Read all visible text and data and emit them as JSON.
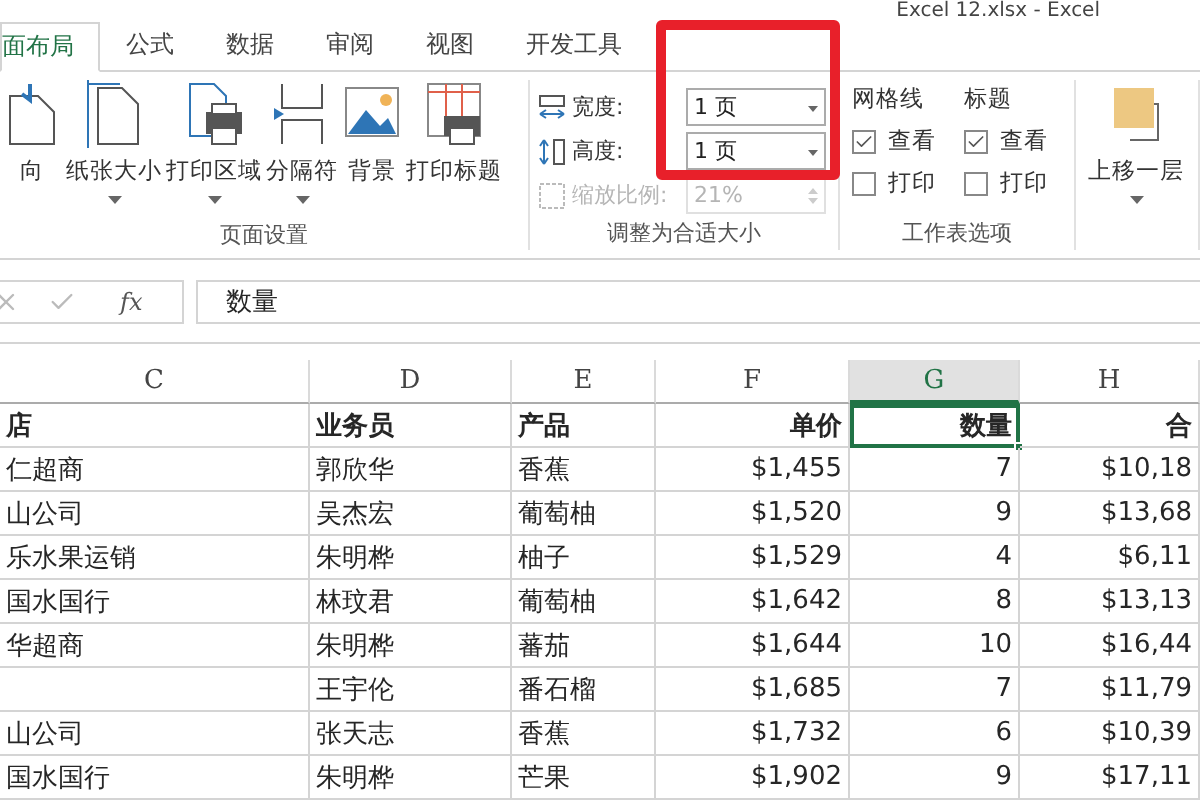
{
  "window": {
    "title": "Excel 12.xlsx - Excel"
  },
  "tabs": [
    {
      "label": "面布局",
      "selected": true
    },
    {
      "label": "公式",
      "selected": false
    },
    {
      "label": "数据",
      "selected": false
    },
    {
      "label": "审阅",
      "selected": false
    },
    {
      "label": "视图",
      "selected": false
    },
    {
      "label": "开发工具",
      "selected": false
    }
  ],
  "ribbon": {
    "page_setup": {
      "label": "页面设置",
      "buttons": [
        {
          "kind": "orientation",
          "label": "向",
          "dropdown": false
        },
        {
          "kind": "size",
          "label": "纸张大小",
          "dropdown": true
        },
        {
          "kind": "print-area",
          "label": "打印区域",
          "dropdown": true
        },
        {
          "kind": "breaks",
          "label": "分隔符",
          "dropdown": true
        },
        {
          "kind": "background",
          "label": "背景",
          "dropdown": false
        },
        {
          "kind": "print-titles",
          "label": "打印标题",
          "dropdown": false
        }
      ]
    },
    "scale_to_fit": {
      "label": "调整为合适大小",
      "highlighted": true,
      "fields": [
        {
          "kind": "width",
          "label": "宽度:",
          "value": "1 页",
          "disabled": false
        },
        {
          "kind": "height",
          "label": "高度:",
          "value": "1 页",
          "disabled": false
        },
        {
          "kind": "scale",
          "label": "缩放比例:",
          "value": "21%",
          "disabled": true
        }
      ]
    },
    "sheet_options": {
      "label": "工作表选项",
      "columns": [
        {
          "title": "网格线",
          "options": [
            {
              "label": "查看",
              "checked": true
            },
            {
              "label": "打印",
              "checked": false
            }
          ]
        },
        {
          "title": "标题",
          "options": [
            {
              "label": "查看",
              "checked": true
            },
            {
              "label": "打印",
              "checked": false
            }
          ]
        }
      ]
    },
    "arrange": {
      "buttons": [
        {
          "label": "上移一层",
          "dropdown": true
        }
      ]
    }
  },
  "formula_bar": {
    "function_label": "fx",
    "value": "数量"
  },
  "sheet": {
    "columns": [
      {
        "label": "C",
        "selected": false
      },
      {
        "label": "D",
        "selected": false
      },
      {
        "label": "E",
        "selected": false
      },
      {
        "label": "F",
        "selected": false
      },
      {
        "label": "G",
        "selected": true
      },
      {
        "label": "H",
        "selected": false
      }
    ],
    "rows": [
      {
        "kind": "header",
        "cells": [
          {
            "text": "店",
            "selected": false
          },
          {
            "text": "业务员",
            "selected": false
          },
          {
            "text": "产品",
            "selected": false
          },
          {
            "text": "单价",
            "selected": false
          },
          {
            "text": "数量",
            "selected": true
          },
          {
            "text": "合",
            "selected": false
          }
        ]
      },
      {
        "kind": "data",
        "cells": [
          {
            "text": "仁超商",
            "selected": false
          },
          {
            "text": "郭欣华",
            "selected": false
          },
          {
            "text": "香蕉",
            "selected": false
          },
          {
            "text": "$1,455",
            "selected": false
          },
          {
            "text": "7",
            "selected": false
          },
          {
            "text": "$10,18",
            "selected": false
          }
        ]
      },
      {
        "kind": "data",
        "cells": [
          {
            "text": "山公司",
            "selected": false
          },
          {
            "text": "吴杰宏",
            "selected": false
          },
          {
            "text": "葡萄柚",
            "selected": false
          },
          {
            "text": "$1,520",
            "selected": false
          },
          {
            "text": "9",
            "selected": false
          },
          {
            "text": "$13,68",
            "selected": false
          }
        ]
      },
      {
        "kind": "data",
        "cells": [
          {
            "text": "乐水果运销",
            "selected": false
          },
          {
            "text": "朱明桦",
            "selected": false
          },
          {
            "text": "柚子",
            "selected": false
          },
          {
            "text": "$1,529",
            "selected": false
          },
          {
            "text": "4",
            "selected": false
          },
          {
            "text": "$6,11",
            "selected": false
          }
        ]
      },
      {
        "kind": "data",
        "cells": [
          {
            "text": "国水国行",
            "selected": false
          },
          {
            "text": "林玟君",
            "selected": false
          },
          {
            "text": "葡萄柚",
            "selected": false
          },
          {
            "text": "$1,642",
            "selected": false
          },
          {
            "text": "8",
            "selected": false
          },
          {
            "text": "$13,13",
            "selected": false
          }
        ]
      },
      {
        "kind": "data",
        "cells": [
          {
            "text": "华超商",
            "selected": false
          },
          {
            "text": "朱明桦",
            "selected": false
          },
          {
            "text": "蕃茄",
            "selected": false
          },
          {
            "text": "$1,644",
            "selected": false
          },
          {
            "text": "10",
            "selected": false
          },
          {
            "text": "$16,44",
            "selected": false
          }
        ]
      },
      {
        "kind": "data",
        "cells": [
          {
            "text": "",
            "selected": false
          },
          {
            "text": "王宇伦",
            "selected": false
          },
          {
            "text": "番石榴",
            "selected": false
          },
          {
            "text": "$1,685",
            "selected": false
          },
          {
            "text": "7",
            "selected": false
          },
          {
            "text": "$11,79",
            "selected": false
          }
        ]
      },
      {
        "kind": "data",
        "cells": [
          {
            "text": "山公司",
            "selected": false
          },
          {
            "text": "张天志",
            "selected": false
          },
          {
            "text": "香蕉",
            "selected": false
          },
          {
            "text": "$1,732",
            "selected": false
          },
          {
            "text": "6",
            "selected": false
          },
          {
            "text": "$10,39",
            "selected": false
          }
        ]
      },
      {
        "kind": "data",
        "cells": [
          {
            "text": "国水国行",
            "selected": false
          },
          {
            "text": "朱明桦",
            "selected": false
          },
          {
            "text": "芒果",
            "selected": false
          },
          {
            "text": "$1,902",
            "selected": false
          },
          {
            "text": "9",
            "selected": false
          },
          {
            "text": "$17,11",
            "selected": false
          }
        ]
      }
    ]
  }
}
